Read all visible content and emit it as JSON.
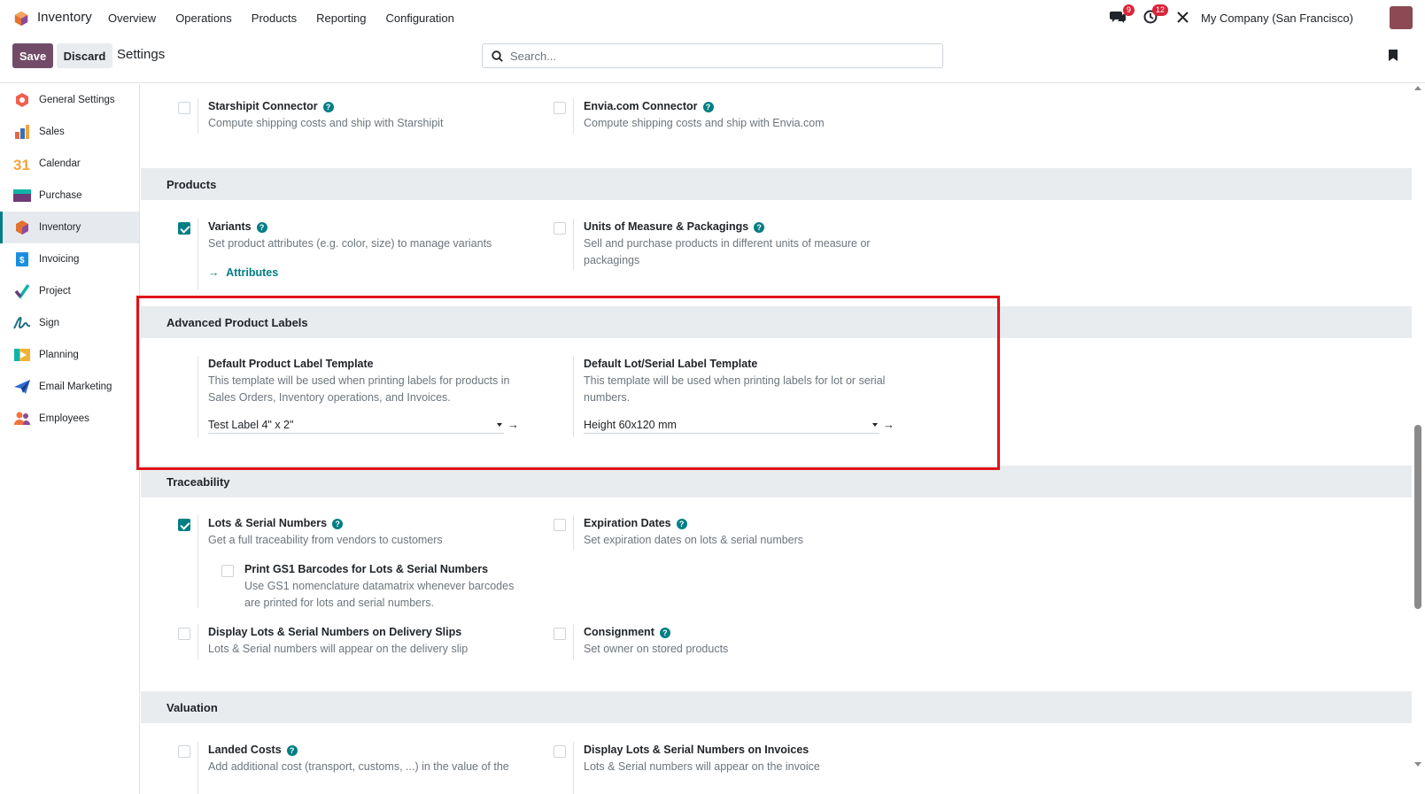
{
  "topnav": {
    "app_name": "Inventory",
    "menu": [
      "Overview",
      "Operations",
      "Products",
      "Reporting",
      "Configuration"
    ],
    "messages_badge": "9",
    "activities_badge": "12",
    "company": "My Company (San Francisco)"
  },
  "controlbar": {
    "save_label": "Save",
    "discard_label": "Discard",
    "title": "Settings",
    "search_placeholder": "Search..."
  },
  "sidebar": {
    "items": [
      {
        "label": "General Settings",
        "icon": "general-settings-icon",
        "color": "#f06050"
      },
      {
        "label": "Sales",
        "icon": "sales-icon",
        "color": "#e26a45"
      },
      {
        "label": "Calendar",
        "icon": "calendar-icon",
        "color": "#f0a53b"
      },
      {
        "label": "Purchase",
        "icon": "purchase-icon",
        "color": "#6d3b77"
      },
      {
        "label": "Inventory",
        "icon": "inventory-icon",
        "color": "#e0732f"
      },
      {
        "label": "Invoicing",
        "icon": "invoicing-icon",
        "color": "#1a8fe0"
      },
      {
        "label": "Project",
        "icon": "project-icon",
        "color": "#0fb3a7"
      },
      {
        "label": "Sign",
        "icon": "sign-icon",
        "color": "#1c6e87"
      },
      {
        "label": "Planning",
        "icon": "planning-icon",
        "color": "#f2b233"
      },
      {
        "label": "Email Marketing",
        "icon": "email-marketing-icon",
        "color": "#2e6ad6"
      },
      {
        "label": "Employees",
        "icon": "employees-icon",
        "color": "#f0733b"
      }
    ],
    "active_index": 4
  },
  "main": {
    "shipping": {
      "starshipit_title": "Starshipit Connector",
      "starshipit_desc": "Compute shipping costs and ship with Starshipit",
      "envia_title": "Envia.com Connector",
      "envia_desc": "Compute shipping costs and ship with Envia.com"
    },
    "products": {
      "heading": "Products",
      "variants_title": "Variants",
      "variants_desc": "Set product attributes (e.g. color, size) to manage variants",
      "attributes_link": "Attributes",
      "uom_title": "Units of Measure & Packagings",
      "uom_desc_1": "Sell and purchase products in different units of measure or",
      "uom_desc_2": "packagings"
    },
    "labels": {
      "heading": "Advanced Product Labels",
      "product_title": "Default Product Label Template",
      "product_desc_1": "This template will be used when printing labels for products in",
      "product_desc_2": "Sales Orders, Inventory operations, and Invoices.",
      "product_value": "Test Label 4\" x 2\"",
      "lot_title": "Default Lot/Serial Label Template",
      "lot_desc_1": "This template will be used when printing labels for lot or serial",
      "lot_desc_2": "numbers.",
      "lot_value": "Height 60x120 mm"
    },
    "traceability": {
      "heading": "Traceability",
      "lots_title": "Lots & Serial Numbers",
      "lots_desc": "Get a full traceability from vendors to customers",
      "gs1_title": "Print GS1 Barcodes for Lots & Serial Numbers",
      "gs1_desc_1": "Use GS1 nomenclature datamatrix whenever barcodes",
      "gs1_desc_2": "are printed for lots and serial numbers.",
      "expiry_title": "Expiration Dates",
      "expiry_desc": "Set expiration dates on lots & serial numbers",
      "delivery_title": "Display Lots & Serial Numbers on Delivery Slips",
      "delivery_desc": "Lots & Serial numbers will appear on the delivery slip",
      "consignment_title": "Consignment",
      "consignment_desc": "Set owner on stored products"
    },
    "valuation": {
      "heading": "Valuation",
      "landed_title": "Landed Costs",
      "landed_desc": "Add additional cost (transport, customs, ...) in the value of the",
      "invoices_title": "Display Lots & Serial Numbers on Invoices",
      "invoices_desc": "Lots & Serial numbers will appear on the invoice"
    }
  },
  "colors": {
    "brand": "#714b67",
    "accent": "#017e84",
    "highlight": "#e0131a"
  }
}
